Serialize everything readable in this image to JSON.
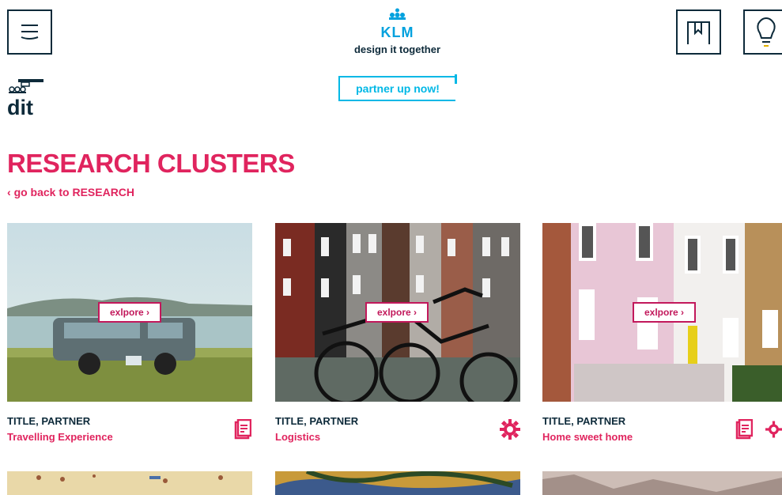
{
  "header": {
    "brand_name": "KLM",
    "tagline": "design it together",
    "partner_cta": "partner up now!",
    "side_logo_text": "dit",
    "icons": [
      "menu-icon",
      "bookmark-icon",
      "lightbulb-icon"
    ]
  },
  "page": {
    "title": "RESEARCH CLUSTERS",
    "back_link": "go back to RESEARCH"
  },
  "cards": [
    {
      "title": "TITLE, PARTNER",
      "subtitle": "Travelling Experience",
      "button": "exlpore",
      "badges": [
        "document-icon"
      ]
    },
    {
      "title": "TITLE, PARTNER",
      "subtitle": "Logistics",
      "button": "exlpore",
      "badges": [
        "gear-icon"
      ]
    },
    {
      "title": "TITLE, PARTNER",
      "subtitle": "Home sweet home",
      "button": "exlpore",
      "badges": [
        "document-icon",
        "gear-icon"
      ]
    }
  ],
  "colors": {
    "accent": "#e0245e",
    "navy": "#0d2a3a",
    "klm_blue": "#00a1de",
    "partner_cyan": "#00b8e6"
  }
}
